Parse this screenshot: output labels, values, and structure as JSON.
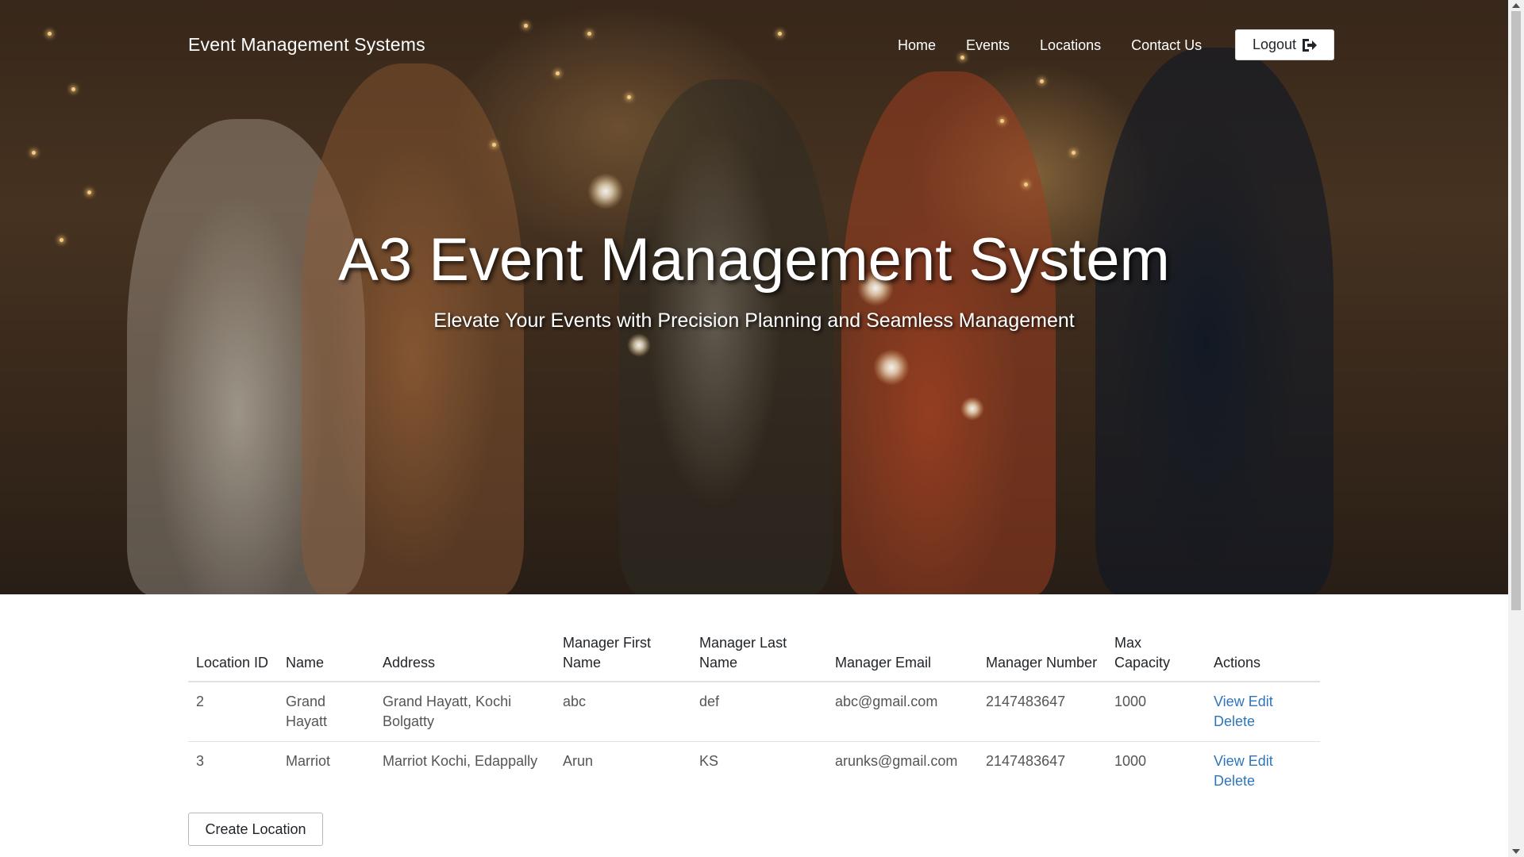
{
  "navbar": {
    "brand": "Event Management Systems",
    "links": [
      "Home",
      "Events",
      "Locations",
      "Contact Us"
    ],
    "logout_label": "Logout",
    "logout_icon": "sign-out-icon"
  },
  "hero": {
    "title": "A3 Event Management System",
    "subtitle": "Elevate Your Events with Precision Planning and Seamless Management",
    "image": "celebration-photo-people-with-sparklers"
  },
  "table": {
    "headers": {
      "location_id": "Location ID",
      "name": "Name",
      "address": "Address",
      "manager_first": "Manager First Name",
      "manager_last": "Manager Last Name",
      "manager_email": "Manager Email",
      "manager_number": "Manager Number",
      "max_capacity": "Max Capacity",
      "actions": "Actions"
    },
    "rows": [
      {
        "id": "2",
        "name": "Grand Hayatt",
        "address": "Grand Hayatt, Kochi Bolgatty",
        "manager_first": "abc",
        "manager_last": "def",
        "manager_email": "abc@gmail.com",
        "manager_number": "2147483647",
        "max_capacity": "1000",
        "view": "View",
        "edit": "Edit",
        "delete": "Delete"
      },
      {
        "id": "3",
        "name": "Marriot",
        "address": "Marriot Kochi, Edappally",
        "manager_first": "Arun",
        "manager_last": "KS",
        "manager_email": "arunks@gmail.com",
        "manager_number": "2147483647",
        "max_capacity": "1000",
        "view": "View",
        "edit": "Edit",
        "delete": "Delete"
      }
    ]
  },
  "create_button": "Create Location",
  "colors": {
    "link": "#2f75bb",
    "table_border": "#dee2e6"
  }
}
